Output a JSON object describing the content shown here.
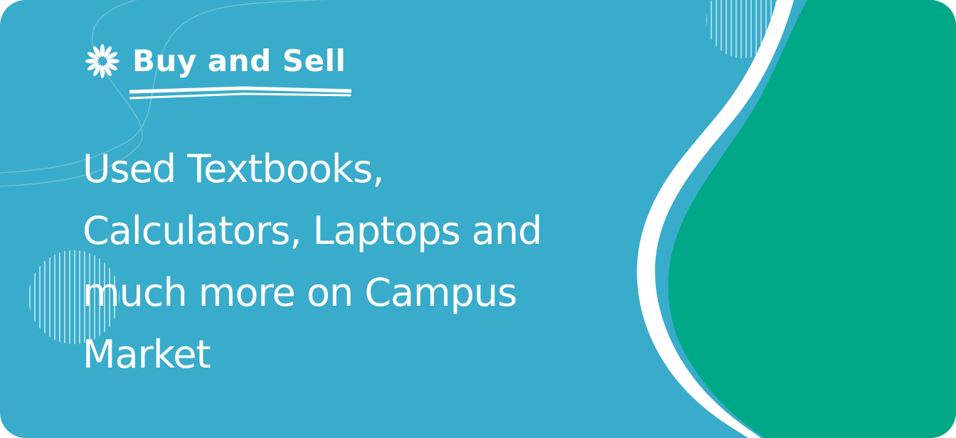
{
  "banner": {
    "tagline": "Buy and Sell",
    "headline_lines": [
      "Used Textbooks,",
      "Calculators, Laptops and",
      "much more on Campus",
      "Market"
    ]
  },
  "colors": {
    "background": "#3aaccb",
    "accent_blob": "#00a887",
    "text": "#ffffff"
  },
  "icons": {
    "tagline_icon": "daisy-flower-icon"
  }
}
